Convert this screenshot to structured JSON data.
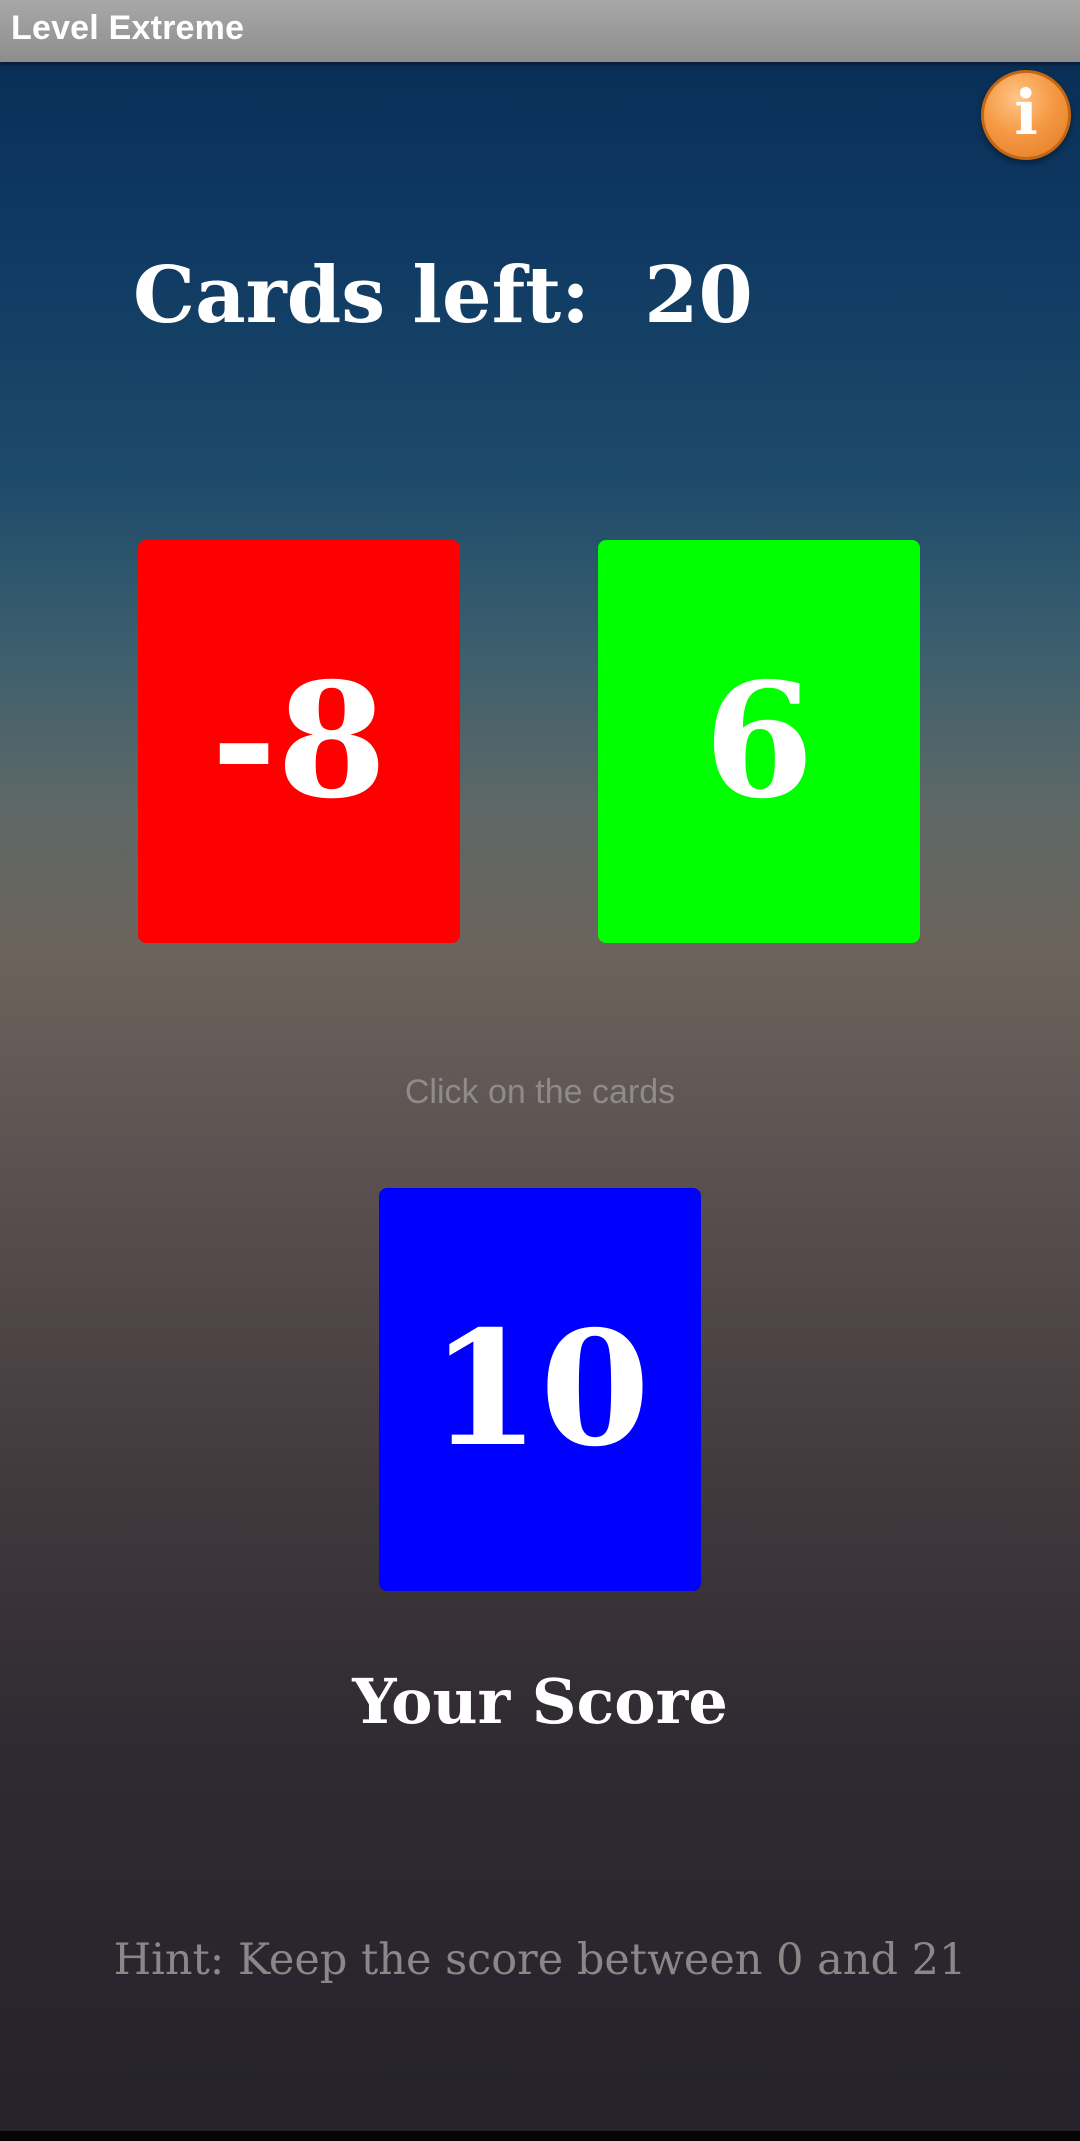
{
  "app_bar": {
    "title": "Level Extreme"
  },
  "info": {
    "icon": "info-icon",
    "glyph": "i"
  },
  "game": {
    "cards_left_label": "Cards left:",
    "cards_left_value": "20",
    "cards": [
      {
        "value": "-8",
        "color": "#ff0000"
      },
      {
        "value": "6",
        "color": "#00ff00"
      }
    ],
    "instruction": "Click on the cards",
    "score": {
      "value": "10",
      "color": "#0000ff",
      "label": "Your Score"
    },
    "hint": "Hint: Keep the score between 0 and 21"
  }
}
